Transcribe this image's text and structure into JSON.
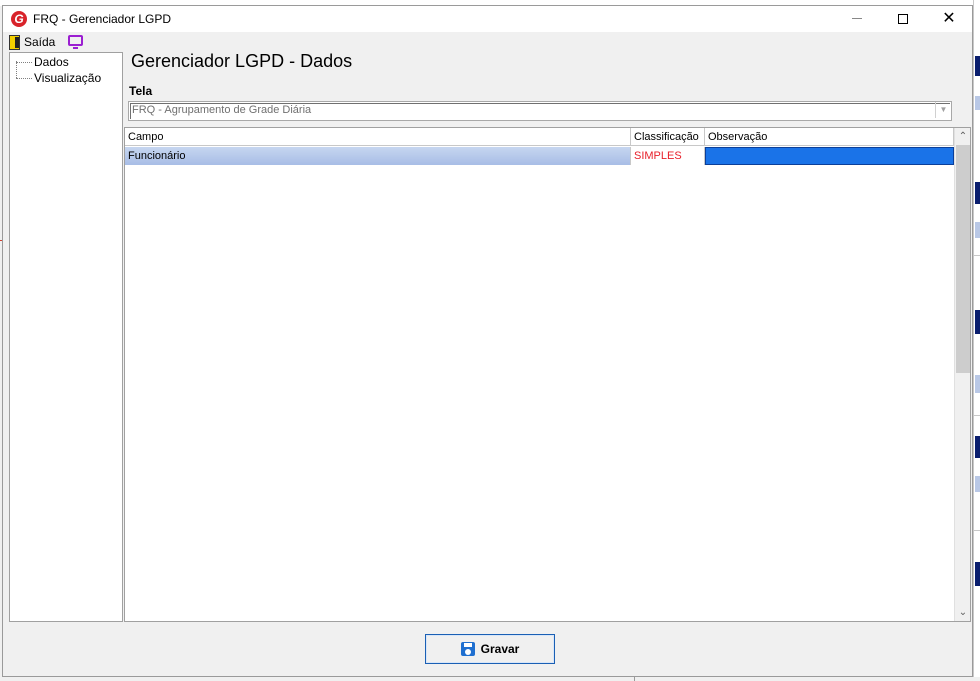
{
  "window": {
    "title": "FRQ - Gerenciador LGPD",
    "logo_letter": "G",
    "minimize_glyph": "",
    "maximize_glyph": "",
    "close_glyph": "✕"
  },
  "toolbar": {
    "exit_label": "Saída",
    "exit_icon": "door-exit-icon",
    "monitor_icon": "monitor-icon"
  },
  "tree": {
    "items": [
      {
        "label": "Dados"
      },
      {
        "label": "Visualização"
      }
    ]
  },
  "main": {
    "heading": "Gerenciador LGPD - Dados",
    "tela_label": "Tela",
    "tela_selected": "FRQ - Agrupamento de Grade Diária"
  },
  "grid": {
    "columns": [
      "Campo",
      "Classificação",
      "Observação"
    ],
    "rows": [
      {
        "campo": "Funcionário",
        "classificacao": "SIMPLES",
        "observacao": ""
      }
    ]
  },
  "footer": {
    "save_label": "Gravar",
    "save_icon": "floppy-disk-icon"
  },
  "colors": {
    "selection_row": "#b5c8ec",
    "classification_text": "#e8202a",
    "active_cell": "#1a73e8",
    "logo": "#d8232a"
  }
}
